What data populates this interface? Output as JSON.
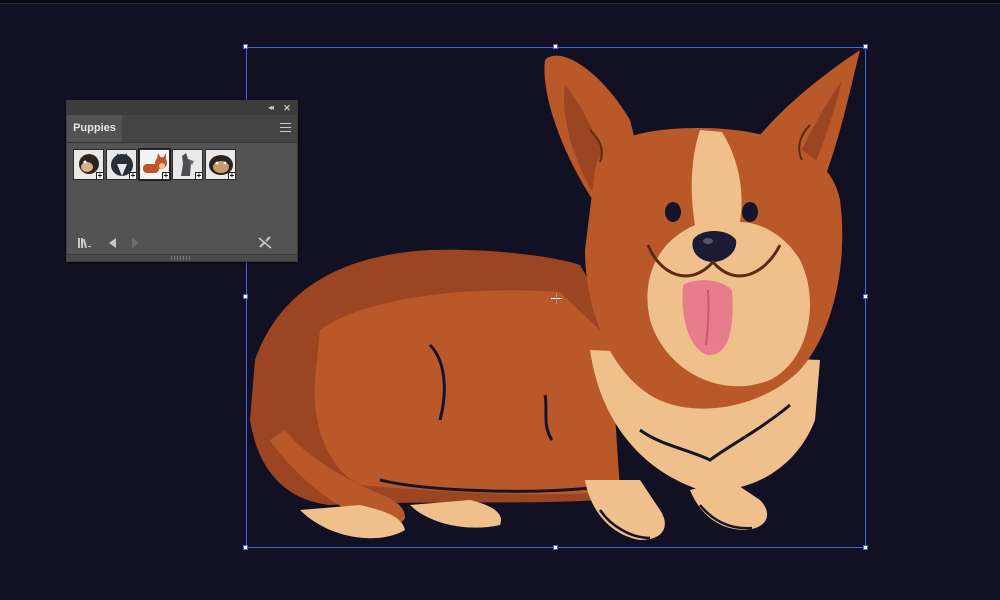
{
  "panel": {
    "tab_label": "Puppies",
    "collapse_glyph": "◂◂",
    "close_glyph": "✕",
    "thumbnails": [
      {
        "name": "pug",
        "selected": false
      },
      {
        "name": "husky",
        "selected": false
      },
      {
        "name": "corgi",
        "selected": true
      },
      {
        "name": "schnauzer",
        "selected": false
      },
      {
        "name": "bulldog",
        "selected": false
      }
    ],
    "footer_icons": [
      "library-icon",
      "previous-icon",
      "next-icon",
      "break-link-icon"
    ]
  },
  "canvas": {
    "artwork": "corgi",
    "selection_color": "#4f63d6",
    "background": "#121123"
  },
  "colors": {
    "fur_dark": "#9c4522",
    "fur": "#b9592a",
    "cream": "#f0c08c",
    "outline": "#14142a",
    "tongue": "#e77d8c",
    "panel": "#535353"
  }
}
